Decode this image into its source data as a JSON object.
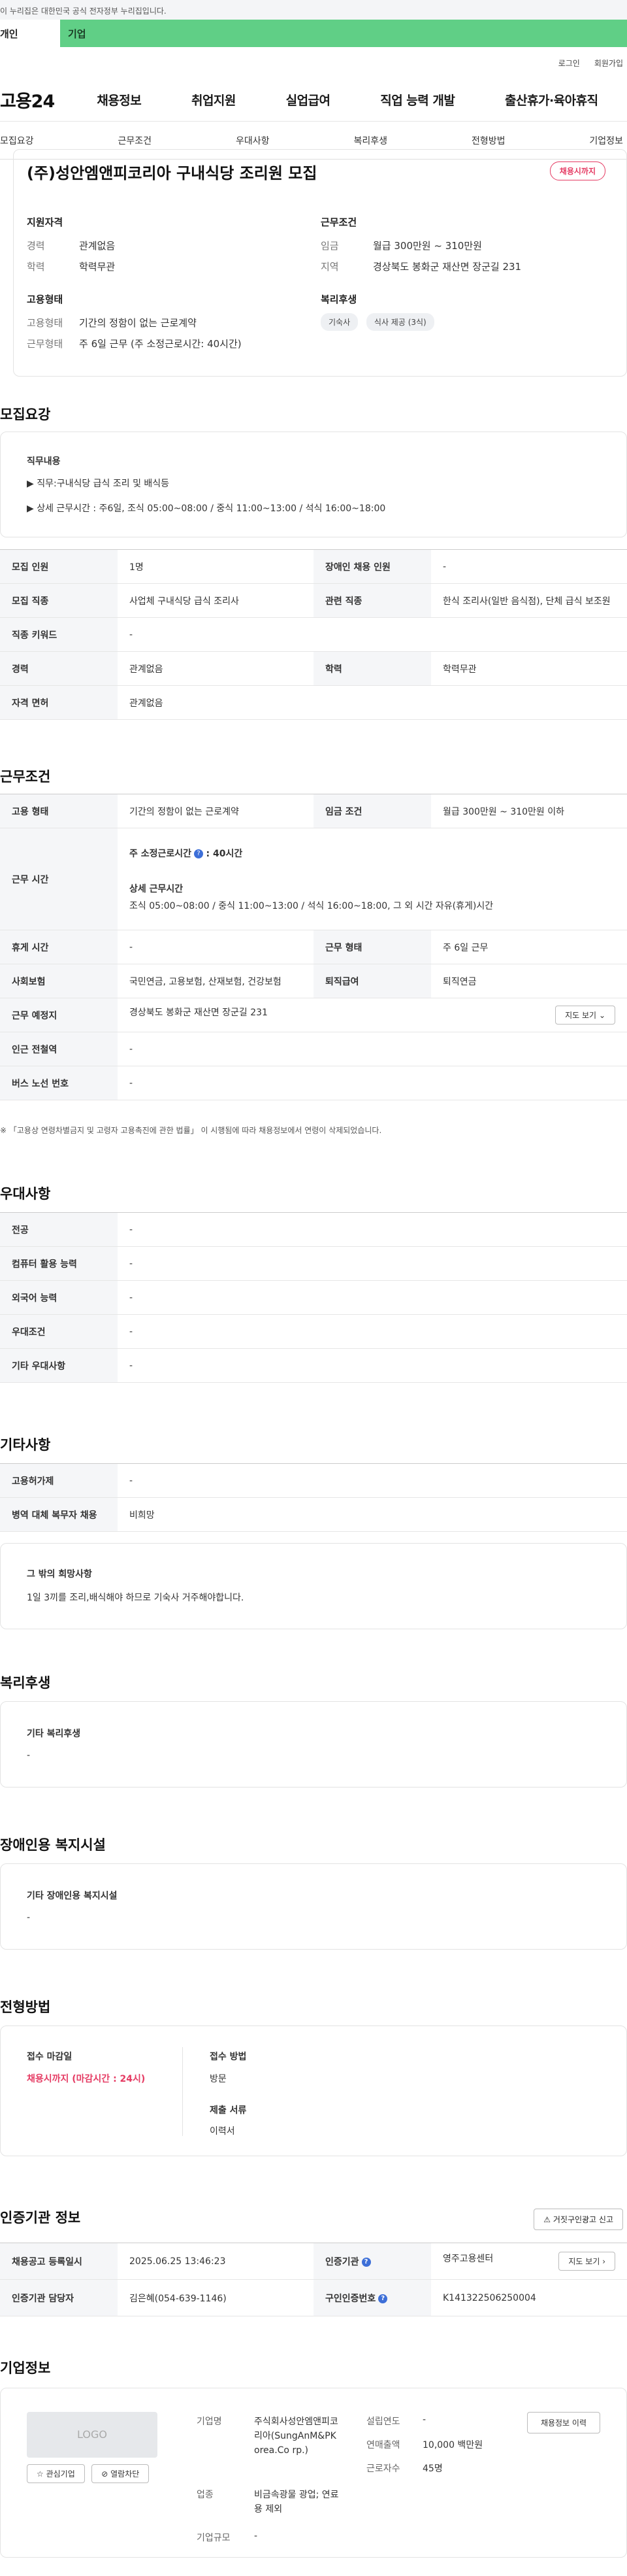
{
  "gov_banner": "이 누리집은 대한민국 공식 전자정부 누리집입니다.",
  "audience": {
    "personal": "개인",
    "company": "기업"
  },
  "util": {
    "login": "로그인",
    "signup": "회원가입"
  },
  "logo": "고용24",
  "gnb": [
    "채용정보",
    "취업지원",
    "실업급여",
    "직업 능력 개발",
    "출산휴가·육아휴직"
  ],
  "tabs": [
    "모집요강",
    "근무조건",
    "우대사항",
    "복리후생",
    "전형방법",
    "기업정보"
  ],
  "job": {
    "title": "(주)성안엠앤피코리아 구내식당 조리원 모집",
    "status": "채용시까지",
    "qual_title": "지원자격",
    "career_k": "경력",
    "career_v": "관계없음",
    "edu_k": "학력",
    "edu_v": "학력무관",
    "emp_title": "고용형태",
    "emp_k": "고용형태",
    "emp_v": "기간의 정함이 없는 근로계약",
    "work_k": "근무형태",
    "work_v": "주 6일 근무 (주 소정근로시간: 40시간)",
    "cond_title": "근무조건",
    "wage_k": "임금",
    "wage_v": "월급 300만원 ~ 310만원",
    "area_k": "지역",
    "area_v": "경상북도 봉화군 재산면 장군길 231",
    "welfare_title": "복리후생",
    "chips": [
      "기숙사",
      "식사 제공 (3식)"
    ]
  },
  "recruit": {
    "heading": "모집요강",
    "duty_title": "직무내용",
    "duty_lines": [
      "▶ 직무:구내식당 급식 조리 및 배식등",
      "▶ 상세 근무시간 : 주6일, 조식 05:00~08:00 / 중식 11:00~13:00 / 석식 16:00~18:00"
    ],
    "rows": [
      [
        "모집 인원",
        "1명",
        "장애인 채용 인원",
        "-"
      ],
      [
        "모집 직종",
        "사업체 구내식당 급식 조리사",
        "관련 직종",
        "한식 조리사(일반 음식점), 단체 급식 보조원"
      ],
      [
        "직종 키워드",
        "-"
      ],
      [
        "경력",
        "관계없음",
        "학력",
        "학력무관"
      ],
      [
        "자격 면허",
        "관계없음"
      ]
    ]
  },
  "work": {
    "heading": "근무조건",
    "type_k": "고용 형태",
    "type_v": "기간의 정함이 없는 근로계약",
    "wage_k": "임금 조건",
    "wage_v": "월급 300만원 ~ 310만원 이하",
    "time_k": "근무 시간",
    "time_week": "주 소정근로시간",
    "time_week_v": ": 40시간",
    "time_detail_t": "상세 근무시간",
    "time_detail_v": "조식 05:00~08:00 / 중식 11:00~13:00 / 석식 16:00~18:00, 그 외 시간 자유(휴게)시간",
    "rest_k": "휴게 시간",
    "rest_v": "-",
    "form_k": "근무 형태",
    "form_v": "주 6일 근무",
    "ins_k": "사회보험",
    "ins_v": "국민연금, 고용보험, 산재보험, 건강보험",
    "ret_k": "퇴직급여",
    "ret_v": "퇴직연금",
    "place_k": "근무 예정지",
    "place_v": "경상북도 봉화군 재산면 장군길 231",
    "map_btn": "지도 보기",
    "station_k": "인근 전철역",
    "station_v": "-",
    "bus_k": "버스 노선 번호",
    "bus_v": "-",
    "note": "※ 「고용상 연령차별금지 및 고령자 고용촉진에 관한 법률」 이 시행됨에 따라 채용정보에서 연령이 삭제되었습니다."
  },
  "pref": {
    "heading": "우대사항",
    "rows": [
      [
        "전공",
        "-"
      ],
      [
        "컴퓨터 활용 능력",
        "-"
      ],
      [
        "외국어 능력",
        "-"
      ],
      [
        "우대조건",
        "-"
      ],
      [
        "기타 우대사항",
        "-"
      ]
    ]
  },
  "etc": {
    "heading": "기타사항",
    "rows": [
      [
        "고용허가제",
        "-"
      ],
      [
        "병역 대체 복무자 채용",
        "비희망"
      ]
    ],
    "wish_title": "그 밖의 희망사항",
    "wish_v": "1일 3끼를 조리,배식해야 하므로 기숙사 거주해야합니다."
  },
  "welfare": {
    "heading": "복리후생",
    "sub": "기타 복리후생",
    "v": "-"
  },
  "disabled": {
    "heading": "장애인용 복지시설",
    "sub": "기타 장애인용 복지시설",
    "v": "-"
  },
  "select": {
    "heading": "전형방법",
    "deadline_t": "접수 마감일",
    "deadline_v": "채용시까지 (마감시간 : 24시)",
    "method_t": "접수 방법",
    "method_v": "방문",
    "docs_t": "제출 서류",
    "docs_v": "이력서"
  },
  "cert": {
    "heading": "인증기관 정보",
    "report_btn": "거짓구인광고 신고",
    "reg_k": "채용공고 등록일시",
    "reg_v": "2025.06.25 13:46:23",
    "org_k": "인증기관",
    "org_v": "영주고용센터",
    "detail_btn": "지도 보기",
    "mgr_k": "인증기관 담당자",
    "mgr_v": "김은혜(054-639-1146)",
    "no_k": "구인인증번호",
    "no_v": "K141322506250004"
  },
  "company": {
    "heading": "기업정보",
    "logo": "LOGO",
    "fav_btn": "관심기업",
    "block_btn": "열람차단",
    "name_k": "기업명",
    "name_v": "주식회사성안엠앤피코리아(SungAnM&PKorea.Co rp.)",
    "biz_k": "업종",
    "biz_v": "비금속광물 광업; 연료용 제외",
    "size_k": "기업규모",
    "size_v": "-",
    "est_k": "설립연도",
    "est_v": "-",
    "sales_k": "연매출액",
    "sales_v": "10,000 백만원",
    "emp_k": "근로자수",
    "emp_v": "45명",
    "history_btn": "채용정보 이력"
  },
  "icons": {
    "help": "help-icon",
    "chevron": "chevron-down-icon",
    "star": "star-icon",
    "block": "block-icon",
    "siren": "siren-icon"
  }
}
